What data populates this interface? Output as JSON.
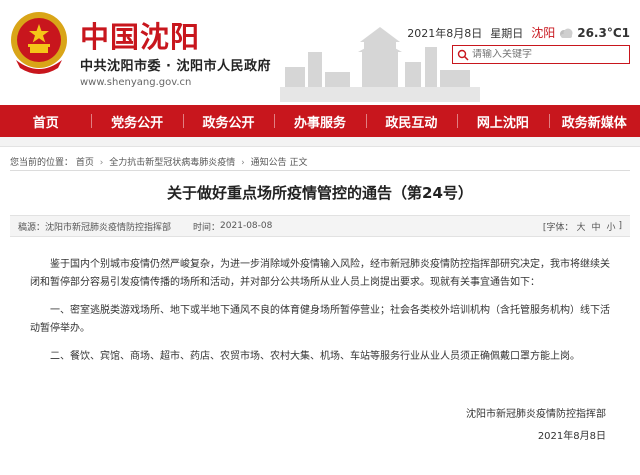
{
  "header": {
    "site_title": "中国沈阳",
    "site_subtitle": "中共沈阳市委 · 沈阳市人民政府",
    "site_url": "www.shenyang.gov.cn",
    "date": "2021年8月8日",
    "weekday": "星期日",
    "city": "沈阳",
    "temperature": "26.3°C",
    "temperature_suffix": "1",
    "search_placeholder": "请输入关键字"
  },
  "colors": {
    "brand_red": "#c8161d",
    "nav_text": "#ffffff"
  },
  "nav": {
    "items": [
      {
        "label": "首页"
      },
      {
        "label": "党务公开"
      },
      {
        "label": "政务公开"
      },
      {
        "label": "办事服务"
      },
      {
        "label": "政民互动"
      },
      {
        "label": "网上沈阳"
      },
      {
        "label": "政务新媒体"
      }
    ]
  },
  "breadcrumb": {
    "prefix": "您当前的位置：",
    "items": [
      "首页",
      "全力抗击新型冠状病毒肺炎疫情",
      "通知公告 正文"
    ]
  },
  "article": {
    "title": "关于做好重点场所疫情管控的通告（第24号）",
    "source_label": "稿源：",
    "source": "沈阳市新冠肺炎疫情防控指挥部",
    "date_label": "时间：",
    "date": "2021-08-08",
    "fontsize_label": "[字体：",
    "fontsize_options": [
      "大",
      "中",
      "小"
    ],
    "fontsize_close": "]",
    "paragraphs": [
      "鉴于国内个别城市疫情仍然严峻复杂，为进一步消除域外疫情输入风险，经市新冠肺炎疫情防控指挥部研究决定，我市将继续关闭和暂停部分容易引发疫情传播的场所和活动，并对部分公共场所从业人员上岗提出要求。现就有关事宜通告如下：",
      "一、密室逃脱类游戏场所、地下或半地下通风不良的体育健身场所暂停营业；社会各类校外培训机构（含托管服务机构）线下活动暂停举办。",
      "二、餐饮、宾馆、商场、超市、药店、农贸市场、农村大集、机场、车站等服务行业从业人员须正确佩戴口罩方能上岗。"
    ],
    "signature": "沈阳市新冠肺炎疫情防控指挥部",
    "signature_date": "2021年8月8日"
  },
  "icons": {
    "emblem": "national-emblem-icon",
    "weather": "cloudy-weather-icon",
    "search": "search-icon"
  }
}
